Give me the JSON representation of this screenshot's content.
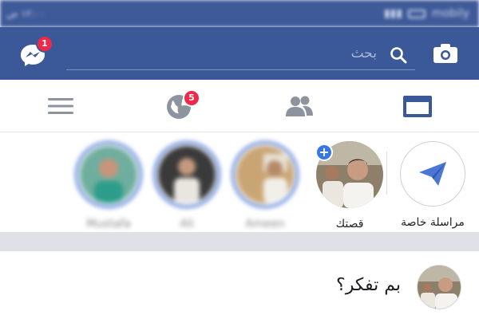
{
  "status_bar": {
    "time": "١٢:٠٠ ص",
    "carrier": "mobily"
  },
  "top_bar": {
    "messenger_badge": "1",
    "search_placeholder": "بحث"
  },
  "nav": {
    "globe_badge": "5",
    "tabs": [
      "menu",
      "notifications",
      "friends",
      "news-feed"
    ]
  },
  "stories": {
    "items": [
      {
        "name": "Mustafa"
      },
      {
        "name": "Ali"
      },
      {
        "name": "Ameen"
      }
    ],
    "own_story_label": "قصتك",
    "direct_label": "مراسلة خاصة"
  },
  "composer": {
    "placeholder": "بم تفكر؟"
  },
  "colors": {
    "brand_blue": "#3b5998",
    "badge_red": "#f02849",
    "story_ring": "#4a76d4",
    "add_blue": "#3578e5"
  },
  "icons": [
    "messenger-icon",
    "search-icon",
    "camera-icon",
    "menu-icon",
    "globe-icon",
    "friends-icon",
    "feed-icon",
    "send-icon",
    "plus-icon"
  ]
}
